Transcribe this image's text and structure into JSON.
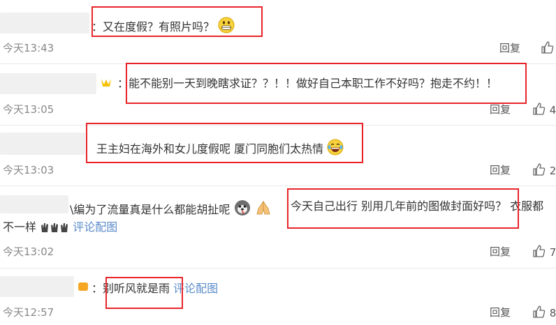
{
  "comments": [
    {
      "text": "：又在度假？有照片吗？",
      "time": "今天13:43",
      "reply": "回复",
      "likes": ""
    },
    {
      "text": "：能不能别一天到晚瞎求证？？！！做好自己本职工作不好吗？抱走不约！！",
      "time": "今天13:05",
      "reply": "回复",
      "likes": "4"
    },
    {
      "text": "王主妇在海外和女儿度假呢 厦门同胞们太热情",
      "time": "今天13:03",
      "reply": "回复",
      "likes": "2"
    },
    {
      "text_line1_a": "\\编为了流量真是什么都能胡扯呢",
      "text_line1_b": "今天自己出行 别用几年前的图做封面好吗？ 衣服都",
      "text_line2": "不一样",
      "link": "评论配图",
      "time": "今天13:02",
      "reply": "回复",
      "likes": "7"
    },
    {
      "text": "：别听风就是雨",
      "link": "评论配图",
      "time": "今天12:57",
      "reply": "回复",
      "likes": "8"
    }
  ],
  "colors": {
    "highlight": "#e8242a",
    "link": "#5a8bc9",
    "meta": "#888888"
  },
  "icons": [
    "grin-emoji",
    "crown-badge",
    "laughing-tears-emoji",
    "dog-emoji",
    "folded-hands-emoji",
    "clapping-hands-emoji",
    "thumbs-up-icon"
  ]
}
